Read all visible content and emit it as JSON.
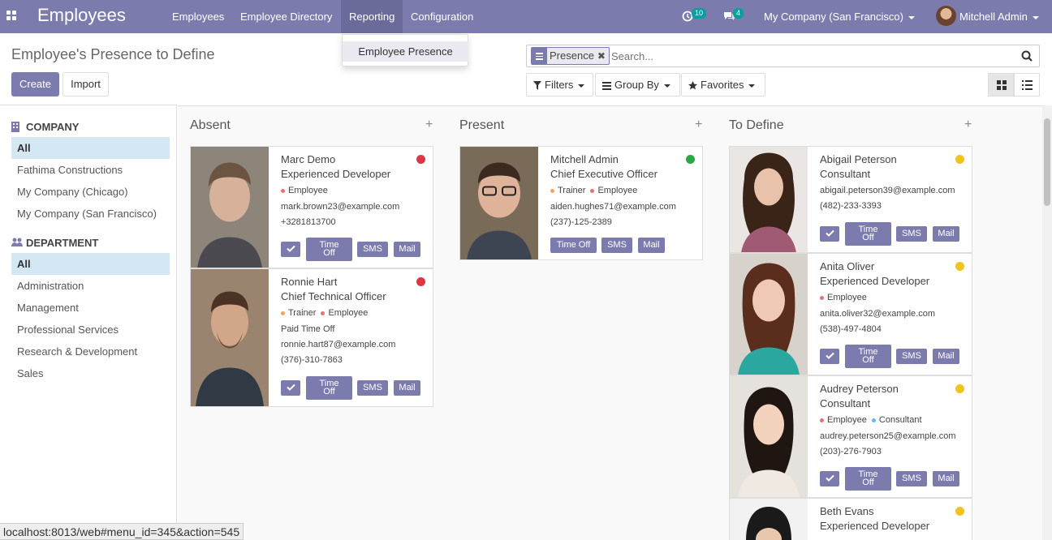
{
  "app": {
    "title": "Employees"
  },
  "nav": {
    "menus": [
      "Employees",
      "Employee Directory",
      "Reporting",
      "Configuration"
    ],
    "active_menu": "Reporting"
  },
  "systray": {
    "activity_count": "10",
    "message_count": "4",
    "company": "My Company (San Francisco)",
    "user": "Mitchell Admin"
  },
  "reporting_menu": {
    "items": [
      "Employee Presence"
    ]
  },
  "control_panel": {
    "title": "Employee's Presence to Define",
    "create_label": "Create",
    "import_label": "Import",
    "facet_label": "Presence",
    "search_placeholder": "Search...",
    "filters_label": "Filters",
    "groupby_label": "Group By",
    "favorites_label": "Favorites"
  },
  "sidebar": {
    "company_header": "COMPANY",
    "companies": [
      "All",
      "Fathima Constructions",
      "My Company (Chicago)",
      "My Company (San Francisco)"
    ],
    "department_header": "DEPARTMENT",
    "departments": [
      "All",
      "Administration",
      "Management",
      "Professional Services",
      "Research & Development",
      "Sales"
    ]
  },
  "columns": [
    {
      "title": "Absent",
      "cards": [
        {
          "name": "Marc Demo",
          "job": "Experienced Developer",
          "tags": [
            "Employee"
          ],
          "presence_text": "",
          "email": "mark.brown23@example.com",
          "phone": "+3281813700"
        },
        {
          "name": "Ronnie Hart",
          "job": "Chief Technical Officer",
          "tags": [
            "Trainer",
            "Employee"
          ],
          "presence_text": "Paid Time Off",
          "email": "ronnie.hart87@example.com",
          "phone": "(376)-310-7863"
        }
      ]
    },
    {
      "title": "Present",
      "cards": [
        {
          "name": "Mitchell Admin",
          "job": "Chief Executive Officer",
          "tags": [
            "Trainer",
            "Employee"
          ],
          "presence_text": "",
          "email": "aiden.hughes71@example.com",
          "phone": "(237)-125-2389"
        }
      ]
    },
    {
      "title": "To Define",
      "cards": [
        {
          "name": "Abigail Peterson",
          "job": "Consultant",
          "tags": [],
          "presence_text": "",
          "email": "abigail.peterson39@example.com",
          "phone": "(482)-233-3393"
        },
        {
          "name": "Anita Oliver",
          "job": "Experienced Developer",
          "tags": [
            "Employee"
          ],
          "presence_text": "",
          "email": "anita.oliver32@example.com",
          "phone": "(538)-497-4804"
        },
        {
          "name": "Audrey Peterson",
          "job": "Consultant",
          "tags": [
            "Employee",
            "Consultant"
          ],
          "presence_text": "",
          "email": "audrey.peterson25@example.com",
          "phone": "(203)-276-7903"
        },
        {
          "name": "Beth Evans",
          "job": "Experienced Developer",
          "tags": [],
          "presence_text": "",
          "email": "",
          "phone": ""
        }
      ]
    }
  ],
  "card_buttons": {
    "timeoff_line1": "Time",
    "timeoff_line2": "Off",
    "timeoff": "Time Off",
    "sms": "SMS",
    "mail": "Mail"
  },
  "status_bar": {
    "url": "localhost:8013/web#menu_id=345&action=545"
  },
  "colors": {
    "brand": "#7c7bad",
    "absent": "#dc3545",
    "present": "#28a745",
    "to_define": "#f0c419",
    "tag_trainer": "#f4a460",
    "tag_employee": "#e57373",
    "tag_consultant": "#64b5f6"
  },
  "icons": [
    "apps-icon",
    "activity-clock-icon",
    "chat-icon",
    "search-icon",
    "filter-icon",
    "group-by-icon",
    "star-icon",
    "kanban-view-icon",
    "list-view-icon",
    "building-icon",
    "users-icon",
    "checkmark-icon",
    "plus-icon",
    "close-icon"
  ]
}
